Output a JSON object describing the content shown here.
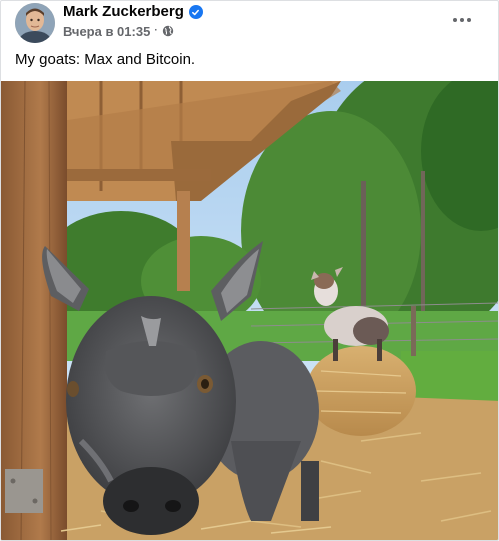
{
  "post": {
    "author": {
      "name": "Mark Zuckerberg",
      "verified": true,
      "avatar_icon": "profile-avatar"
    },
    "timestamp": "Вчера в 01:35",
    "separator": "·",
    "privacy_icon": "globe-icon",
    "more_icon": "more-options-icon",
    "caption": "My goats: Max and Bitcoin.",
    "photo_icon": "goats-photo"
  },
  "colors": {
    "verified_blue": "#1877f2",
    "meta_gray": "#65676b",
    "text": "#050505"
  }
}
